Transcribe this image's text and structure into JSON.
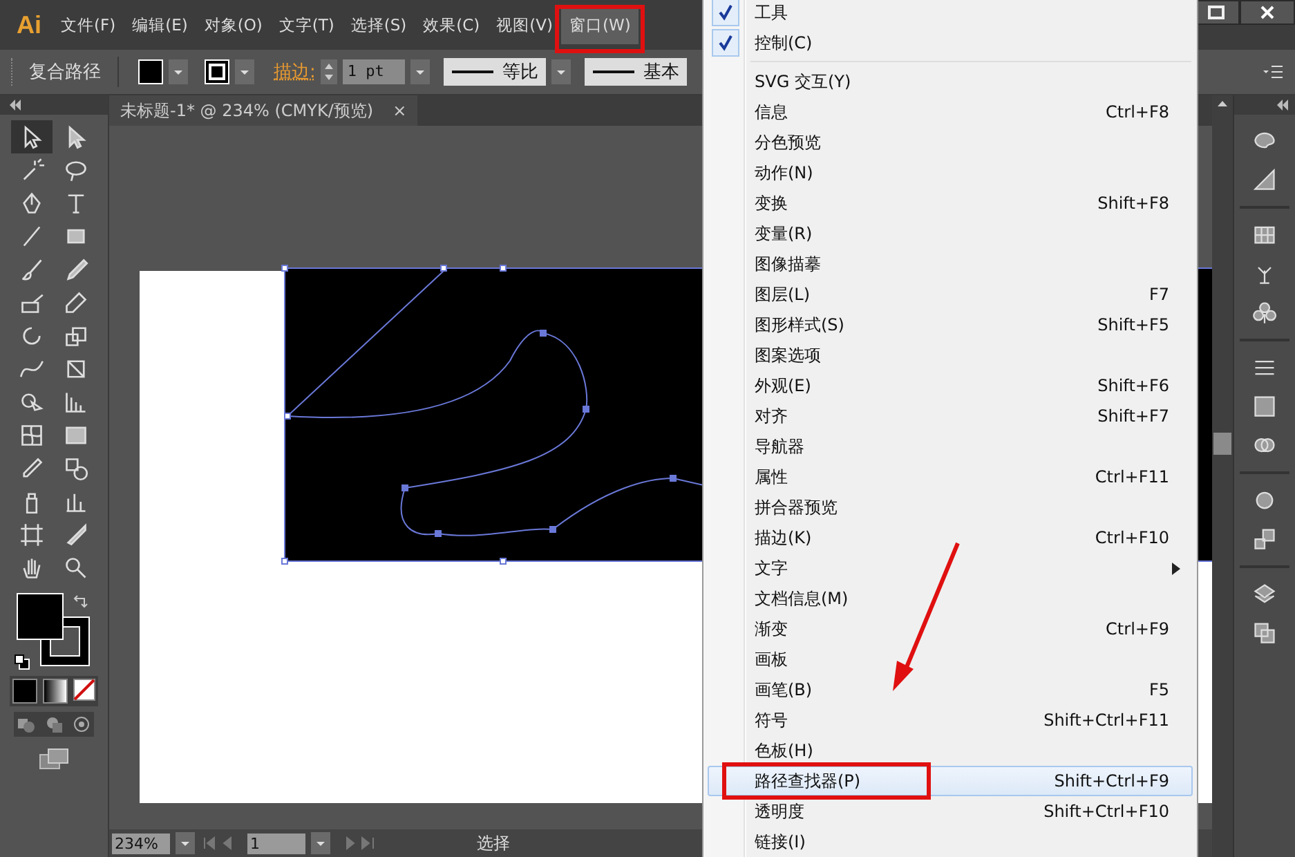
{
  "app": {
    "logo": "Ai"
  },
  "menubar": {
    "items": [
      {
        "label": "文件(F)",
        "selected": false
      },
      {
        "label": "编辑(E)",
        "selected": false
      },
      {
        "label": "对象(O)",
        "selected": false
      },
      {
        "label": "文字(T)",
        "selected": false
      },
      {
        "label": "选择(S)",
        "selected": false
      },
      {
        "label": "效果(C)",
        "selected": false
      },
      {
        "label": "视图(V)",
        "selected": false
      },
      {
        "label": "窗口(W)",
        "selected": true
      }
    ]
  },
  "control_bar": {
    "object_type": "复合路径",
    "stroke_label": "描边:",
    "stroke_weight": "1 pt",
    "profile": "等比",
    "brush": "基本"
  },
  "document_tab": {
    "title": "未标题-1* @ 234% (CMYK/预览)",
    "close": "×"
  },
  "toolbox": {
    "tools": [
      {
        "selected": true
      },
      {
        "selected": false
      },
      {
        "selected": false
      },
      {
        "selected": false
      },
      {
        "selected": false
      },
      {
        "selected": false
      },
      {
        "selected": false
      },
      {
        "selected": false
      },
      {
        "selected": false
      },
      {
        "selected": false
      },
      {
        "selected": false
      },
      {
        "selected": false
      },
      {
        "selected": false
      },
      {
        "selected": false
      },
      {
        "selected": false
      },
      {
        "selected": false
      },
      {
        "selected": false
      },
      {
        "selected": false
      },
      {
        "selected": false
      },
      {
        "selected": false
      },
      {
        "selected": false
      },
      {
        "selected": false
      },
      {
        "selected": false
      },
      {
        "selected": false
      },
      {
        "selected": false
      },
      {
        "selected": false
      },
      {
        "selected": false
      },
      {
        "selected": false
      }
    ]
  },
  "status_bar": {
    "zoom": "234%",
    "artboard": "1",
    "tool": "选择"
  },
  "window_menu": {
    "groups": [
      [
        {
          "label": "工具",
          "kind": "command",
          "checked": true,
          "selected": false
        },
        {
          "label": "控制(C)",
          "kind": "command",
          "checked": true,
          "selected": false
        }
      ],
      [
        {
          "label": "SVG 交互(Y)",
          "kind": "command",
          "checked": false,
          "selected": false
        },
        {
          "label": "信息",
          "shortcut": "Ctrl+F8",
          "kind": "command",
          "checked": false,
          "selected": false
        },
        {
          "label": "分色预览",
          "kind": "command",
          "checked": false,
          "selected": false
        },
        {
          "label": "动作(N)",
          "kind": "command",
          "checked": false,
          "selected": false
        },
        {
          "label": "变换",
          "shortcut": "Shift+F8",
          "kind": "command",
          "checked": false,
          "selected": false
        },
        {
          "label": "变量(R)",
          "kind": "command",
          "checked": false,
          "selected": false
        },
        {
          "label": "图像描摹",
          "kind": "command",
          "checked": false,
          "selected": false
        },
        {
          "label": "图层(L)",
          "shortcut": "F7",
          "kind": "command",
          "checked": false,
          "selected": false
        },
        {
          "label": "图形样式(S)",
          "shortcut": "Shift+F5",
          "kind": "command",
          "checked": false,
          "selected": false
        },
        {
          "label": "图案选项",
          "kind": "command",
          "checked": false,
          "selected": false
        },
        {
          "label": "外观(E)",
          "shortcut": "Shift+F6",
          "kind": "command",
          "checked": false,
          "selected": false
        },
        {
          "label": "对齐",
          "shortcut": "Shift+F7",
          "kind": "command",
          "checked": false,
          "selected": false
        },
        {
          "label": "导航器",
          "kind": "command",
          "checked": false,
          "selected": false
        },
        {
          "label": "属性",
          "shortcut": "Ctrl+F11",
          "kind": "command",
          "checked": false,
          "selected": false
        },
        {
          "label": "拼合器预览",
          "kind": "command",
          "checked": false,
          "selected": false
        },
        {
          "label": "描边(K)",
          "shortcut": "Ctrl+F10",
          "kind": "command",
          "checked": false,
          "selected": false
        },
        {
          "label": "文字",
          "kind": "submenu",
          "checked": false,
          "selected": false
        },
        {
          "label": "文档信息(M)",
          "kind": "command",
          "checked": false,
          "selected": false
        },
        {
          "label": "渐变",
          "shortcut": "Ctrl+F9",
          "kind": "command",
          "checked": false,
          "selected": false
        },
        {
          "label": "画板",
          "kind": "command",
          "checked": false,
          "selected": false
        },
        {
          "label": "画笔(B)",
          "shortcut": "F5",
          "kind": "command",
          "checked": false,
          "selected": false
        },
        {
          "label": "符号",
          "shortcut": "Shift+Ctrl+F11",
          "kind": "command",
          "checked": false,
          "selected": false
        },
        {
          "label": "色板(H)",
          "kind": "command",
          "checked": false,
          "selected": false
        },
        {
          "label": "路径查找器(P)",
          "shortcut": "Shift+Ctrl+F9",
          "kind": "command",
          "checked": false,
          "selected": true
        },
        {
          "label": "透明度",
          "shortcut": "Shift+Ctrl+F10",
          "kind": "command",
          "checked": false,
          "selected": false
        },
        {
          "label": "链接(I)",
          "kind": "command",
          "checked": false,
          "selected": false
        }
      ]
    ]
  }
}
